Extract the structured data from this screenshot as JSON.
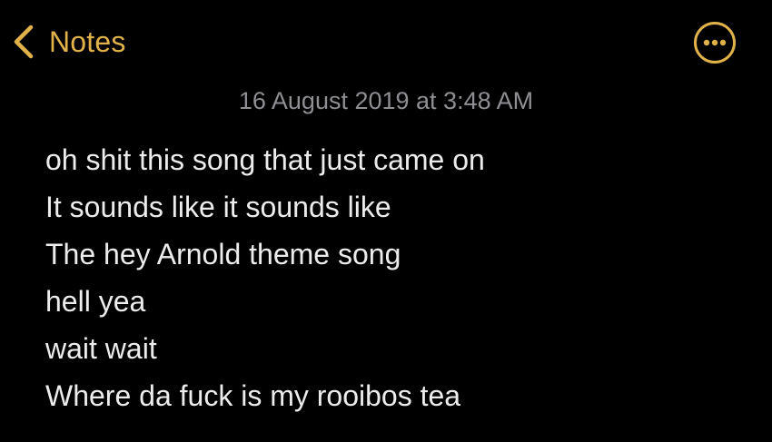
{
  "colors": {
    "accent": "#e2b24a",
    "background": "#000000",
    "date_text": "#8e8e93",
    "body_text": "#ececec"
  },
  "nav": {
    "back_label": "Notes",
    "back_icon": "chevron-left-icon",
    "more_icon": "ellipsis-circle-icon"
  },
  "note": {
    "date": "16 August 2019 at 3:48 AM",
    "lines": [
      "oh shit this song that just came on",
      "It sounds like it sounds like",
      "The hey Arnold theme song",
      "hell yea",
      "wait wait",
      "Where da fuck is my rooibos tea"
    ]
  }
}
